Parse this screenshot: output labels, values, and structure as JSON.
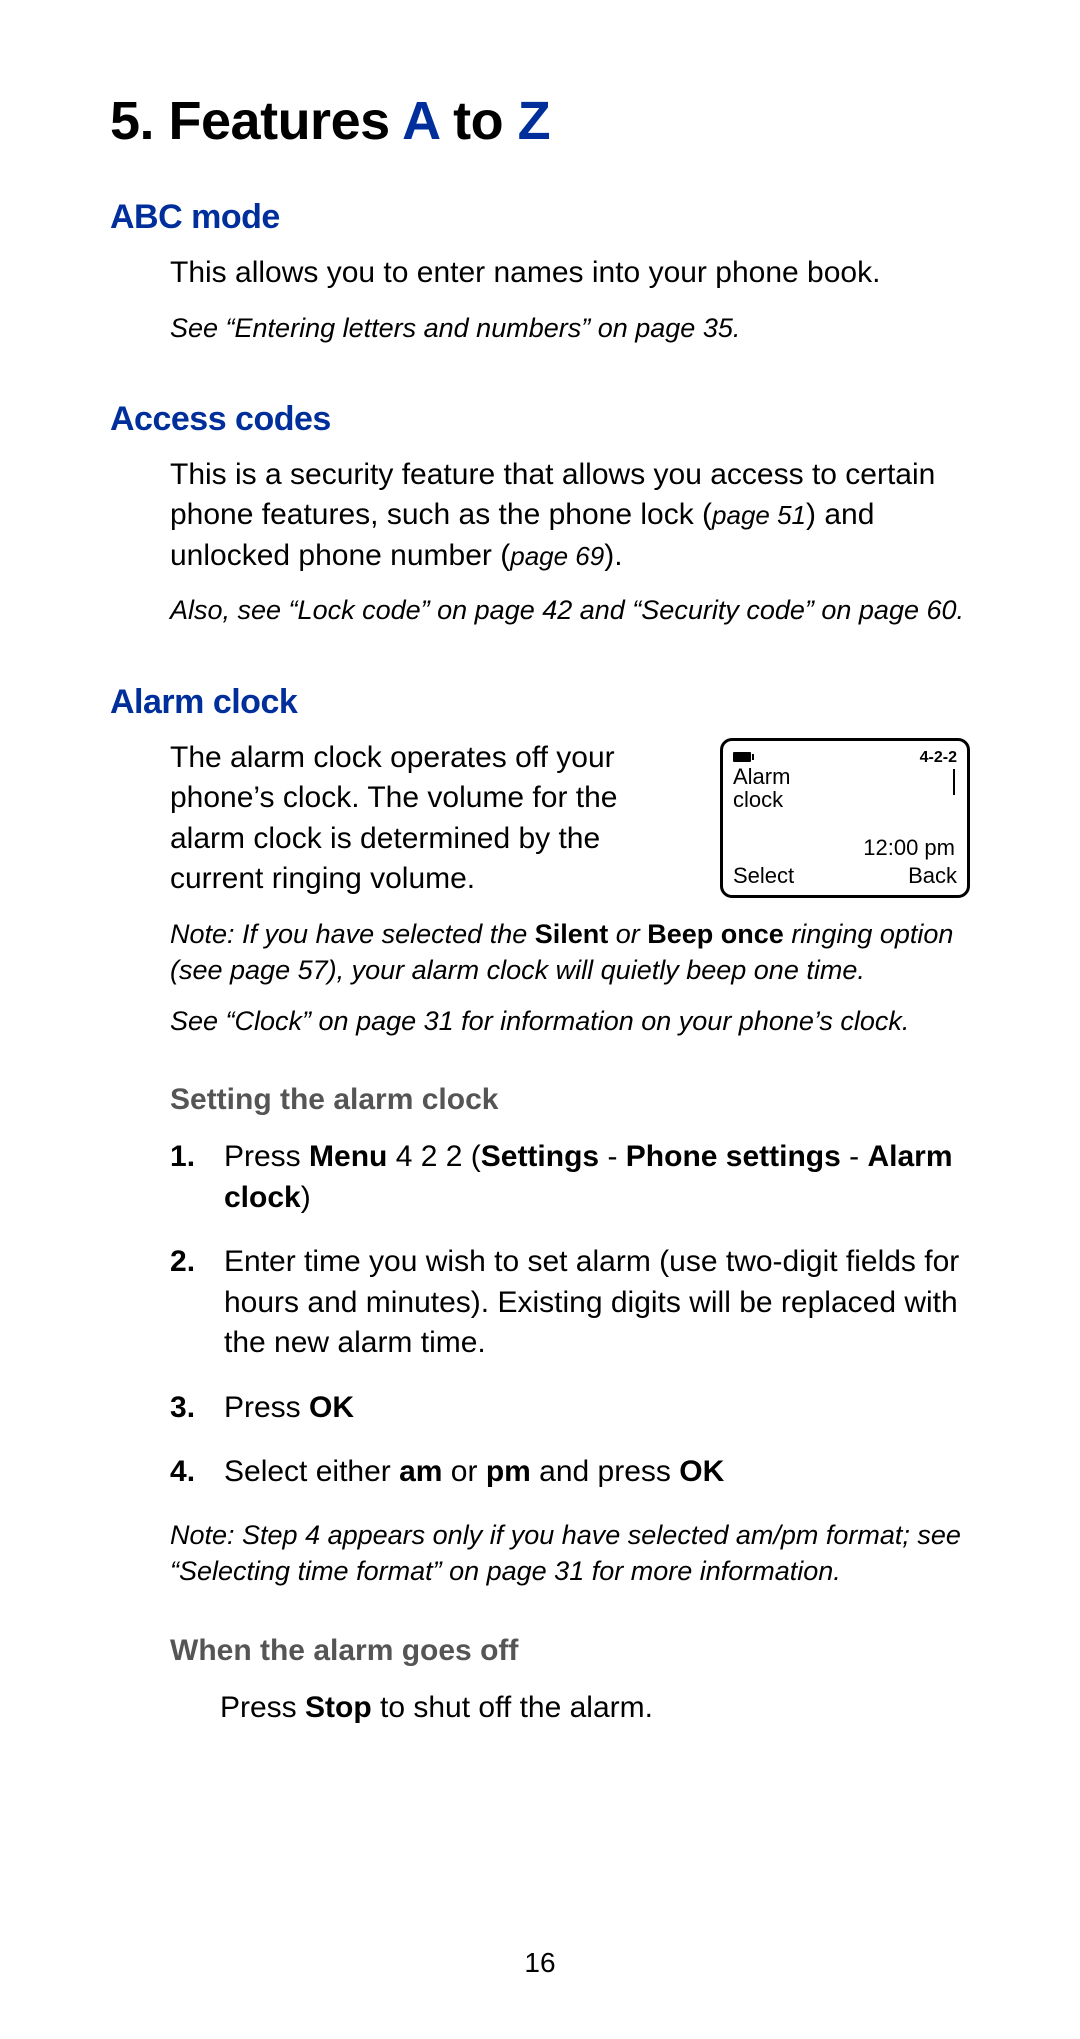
{
  "title": {
    "prefix": "5. Features ",
    "A": "A",
    "mid": " to ",
    "Z": "Z"
  },
  "sections": {
    "abc": {
      "heading": "ABC mode",
      "body": "This allows you to enter names into your phone book.",
      "ref": "See “Entering letters and numbers” on page 35."
    },
    "access": {
      "heading": "Access codes",
      "body_a": "This is a security feature that allows you access to certain phone features, such as the phone lock (",
      "page51": "page 51",
      "body_b": ") and unlocked phone number (",
      "page69": "page 69",
      "body_c": ").",
      "ref": "Also, see “Lock code” on page 42 and “Security code” on page 60."
    },
    "alarm": {
      "heading": "Alarm clock",
      "body": "The alarm clock operates off your phone’s clock. The volume for the alarm clock is determined by the current ringing volume.",
      "note1_a": "Note: If you have selected the ",
      "note1_silent": "Silent",
      "note1_b": " or ",
      "note1_beep": "Beep once",
      "note1_c": " ringing option (see page 57), your alarm clock will quietly beep one time.",
      "ref2": "See “Clock” on page 31 for information on your phone’s clock.",
      "sub_setting": "Setting the alarm clock",
      "step1_a": "Press ",
      "step1_menu": "Menu",
      "step1_b": " 4 2 2 (",
      "step1_settings": "Settings",
      "step1_dash1": " - ",
      "step1_phone": "Phone settings",
      "step1_dash2": " - ",
      "step1_alarm": "Alarm clock",
      "step1_c": ")",
      "step2": "Enter time you wish to set alarm (use two-digit fields for hours and minutes). Existing digits will be replaced with the new alarm time.",
      "step3_a": "Press ",
      "step3_ok": "OK",
      "step4_a": "Select either ",
      "step4_am": "am",
      "step4_b": " or ",
      "step4_pm": "pm",
      "step4_c": " and press ",
      "step4_ok": "OK",
      "note2": "Note: Step 4 appears only if you have selected am/pm format; see “Selecting time format” on page 31 for more information.",
      "sub_goesoff": "When the alarm goes off",
      "goesoff_a": "Press ",
      "goesoff_stop": "Stop",
      "goesoff_b": " to shut off the alarm."
    }
  },
  "phone": {
    "menucode": "4-2-2",
    "title_l1": "Alarm",
    "title_l2": "clock",
    "time": "12:00 pm",
    "left": "Select",
    "right": "Back"
  },
  "page_number": "16"
}
